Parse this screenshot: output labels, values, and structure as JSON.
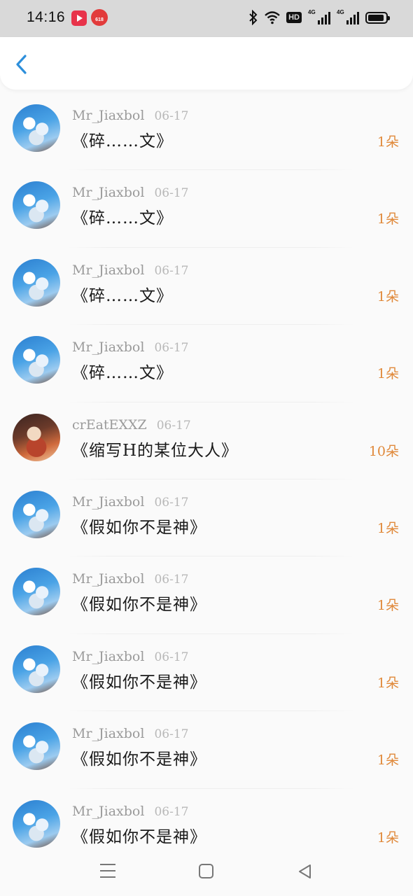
{
  "status_bar": {
    "time": "14:16",
    "app_badge_text": "618",
    "hd_label": "HD",
    "network_1": "4G",
    "network_2": "4G"
  },
  "nav": {
    "back_icon": "chevron-left-icon",
    "accent_color": "#2d8fdb"
  },
  "colors": {
    "count": "#e0893a",
    "username": "#9a9a9a",
    "title": "#1a1a1a"
  },
  "items": [
    {
      "user": "Mr_Jiaxbol",
      "date": "06-17",
      "title": "《碎……文》",
      "count": "1朵",
      "avatar": "sky-avatar"
    },
    {
      "user": "Mr_Jiaxbol",
      "date": "06-17",
      "title": "《碎……文》",
      "count": "1朵",
      "avatar": "sky-avatar"
    },
    {
      "user": "Mr_Jiaxbol",
      "date": "06-17",
      "title": "《碎……文》",
      "count": "1朵",
      "avatar": "sky-avatar"
    },
    {
      "user": "Mr_Jiaxbol",
      "date": "06-17",
      "title": "《碎……文》",
      "count": "1朵",
      "avatar": "sky-avatar"
    },
    {
      "user": "crEatEXXZ",
      "date": "06-17",
      "title": "《缩写H的某位大人》",
      "count": "10朵",
      "avatar": "character-avatar"
    },
    {
      "user": "Mr_Jiaxbol",
      "date": "06-17",
      "title": "《假如你不是神》",
      "count": "1朵",
      "avatar": "sky-avatar"
    },
    {
      "user": "Mr_Jiaxbol",
      "date": "06-17",
      "title": "《假如你不是神》",
      "count": "1朵",
      "avatar": "sky-avatar"
    },
    {
      "user": "Mr_Jiaxbol",
      "date": "06-17",
      "title": "《假如你不是神》",
      "count": "1朵",
      "avatar": "sky-avatar"
    },
    {
      "user": "Mr_Jiaxbol",
      "date": "06-17",
      "title": "《假如你不是神》",
      "count": "1朵",
      "avatar": "sky-avatar"
    },
    {
      "user": "Mr_Jiaxbol",
      "date": "06-17",
      "title": "《假如你不是神》",
      "count": "1朵",
      "avatar": "sky-avatar"
    }
  ]
}
